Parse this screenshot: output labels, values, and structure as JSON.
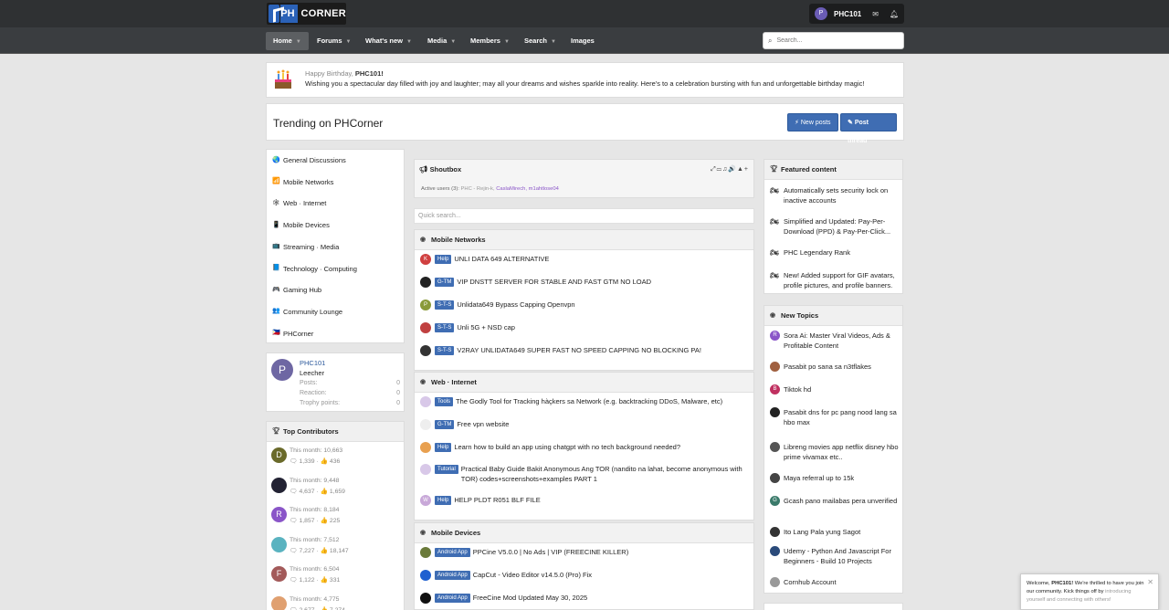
{
  "header": {
    "logo_ph": "PH",
    "logo_corner": "CORNER",
    "username": "PHC101",
    "avatar_letter": "P"
  },
  "nav": {
    "items": [
      "Home",
      "Forums",
      "What's new",
      "Media",
      "Members",
      "Search",
      "Images"
    ],
    "search_placeholder": "Search..."
  },
  "birthday": {
    "greeting": "Happy Birthday, ",
    "user": "PHC101!",
    "message": "Wishing you a spectacular day filled with joy and laughter; may all your dreams and wishes sparkle into reality. Here's to a celebration bursting with fun and unforgettable birthday magic!"
  },
  "trending": {
    "title": "Trending on PHCorner",
    "new_posts": "New posts",
    "post_thread": "Post thread"
  },
  "forums": [
    {
      "label": "General Discussions",
      "icon": "globe-icon",
      "glyph": "🌏"
    },
    {
      "label": "Mobile Networks",
      "icon": "signal-icon",
      "glyph": "📶"
    },
    {
      "label": "Web · Internet",
      "icon": "web-icon",
      "glyph": "🕸"
    },
    {
      "label": "Mobile Devices",
      "icon": "phone-icon",
      "glyph": "📱"
    },
    {
      "label": "Streaming · Media",
      "icon": "tv-icon",
      "glyph": "📺"
    },
    {
      "label": "Technology · Computing",
      "icon": "book-icon",
      "glyph": "📘"
    },
    {
      "label": "Gaming Hub",
      "icon": "gamepad-icon",
      "glyph": "🎮"
    },
    {
      "label": "Community Lounge",
      "icon": "people-icon",
      "glyph": "👥"
    },
    {
      "label": "PHCorner",
      "icon": "flag-icon",
      "glyph": "🇵🇭"
    }
  ],
  "profile": {
    "avatar_letter": "P",
    "name": "PHC101",
    "rank": "Leecher",
    "stats": [
      {
        "label": "Posts:",
        "value": "0"
      },
      {
        "label": "Reaction:",
        "value": "0"
      },
      {
        "label": "Trophy points:",
        "value": "0"
      }
    ]
  },
  "contributors": {
    "title": "Top Contributors",
    "items": [
      {
        "letter": "D",
        "color": "#6a6a2a",
        "month": "This month: 10,663",
        "stats": "🗨 1,339 · 👍 436"
      },
      {
        "letter": "",
        "color": "#223",
        "month": "This month: 9,448",
        "stats": "🗨 4,637 · 👍 1,659"
      },
      {
        "letter": "R",
        "color": "#8a55c8",
        "month": "This month: 8,184",
        "stats": "🗨 1,857 · 👍 225"
      },
      {
        "letter": "",
        "color": "#5ab3c0",
        "month": "This month: 7,512",
        "stats": "🗨 7,227 · 👍 18,147"
      },
      {
        "letter": "F",
        "color": "#a35a5a",
        "month": "This month: 6,504",
        "stats": "🗨 1,122 · 👍 331"
      },
      {
        "letter": "",
        "color": "#e0a070",
        "month": "This month: 4,775",
        "stats": "🗨 2,677 · 👍 7,274"
      }
    ]
  },
  "shoutbox": {
    "title": "Shoutbox",
    "active_label": "Active users (3):",
    "users": [
      "PHC - Rejin-k,",
      "CaslaMirech,",
      "m1ahtlose04"
    ],
    "quick_search": "Quick search..."
  },
  "sections": [
    {
      "title": "Mobile Networks",
      "rows": [
        {
          "av": "K",
          "color": "#d04040",
          "tag": "Help",
          "text": "UNLI DATA 649 ALTERNATIVE"
        },
        {
          "av": "",
          "color": "#222",
          "tag": "G-TM",
          "text": "VIP DNSTT SERVER FOR STABLE AND FAST GTM NO LOAD"
        },
        {
          "av": "P",
          "color": "#8a9a3a",
          "tag": "S-T-S",
          "text": "Unlidata649 Bypass Capping Openvpn"
        },
        {
          "av": "",
          "color": "#c04040",
          "tag": "S-T-S",
          "text": "Unli 5G + NSD cap"
        },
        {
          "av": "",
          "color": "#333",
          "tag": "S-T-S",
          "text": "V2RAY UNLIDATA649 SUPER FAST NO SPEED CAPPING NO BLOCKING PA!"
        }
      ]
    },
    {
      "title": "Web · Internet",
      "rows": [
        {
          "av": "",
          "color": "#d8c8e8",
          "tag": "Tools",
          "text": "The Godly Tool for Tracking hàçkers sa Network (e.g. backtracking DDoS, Malware, etc)"
        },
        {
          "av": "",
          "color": "#eee",
          "tag": "G-TM",
          "text": "Free vpn website"
        },
        {
          "av": "",
          "color": "#e8a050",
          "tag": "Help",
          "text": "Learn how to build an app using chatgpt with no tech background needed?"
        },
        {
          "av": "",
          "color": "#d8c8e8",
          "tag": "Tutorial",
          "text": "Practical Baby Guide Bakit Anonymous Ang TOR (nandito na lahat, become anonymous with TOR) codes+screenshots+examples PART 1"
        },
        {
          "av": "W",
          "color": "#c8a8d8",
          "tag": "Help",
          "text": "HELP PLDT R051 BLF FILE"
        }
      ]
    },
    {
      "title": "Mobile Devices",
      "rows": [
        {
          "av": "",
          "color": "#6a7a3a",
          "tag": "Android App",
          "text": "PPCine V5.0.0 | No Ads | VIP (FREECINE KILLER)"
        },
        {
          "av": "",
          "color": "#2060d0",
          "tag": "Android App",
          "text": "CapCut - Video Editor v14.5.0 (Pro) Fix"
        },
        {
          "av": "",
          "color": "#111",
          "tag": "Android App",
          "text": "FreeCine Mod Updated May 30, 2025"
        }
      ]
    }
  ],
  "featured": {
    "title": "Featured content",
    "items": [
      "Automatically sets security lock on inactive accounts",
      "Simplified and Updated: Pay-Per-Download (PPD) & Pay-Per-Click...",
      "PHC Legendary Rank",
      "New! Added support for GIF avatars, profile pictures, and profile banners."
    ]
  },
  "new_topics": {
    "title": "New Topics",
    "items": [
      {
        "av": "R",
        "color": "#8a55c8",
        "text": "Sora Ai: Master Viral Videos, Ads & Profitable Content"
      },
      {
        "av": "",
        "color": "#a06040",
        "text": "Pasabit po sana sa n3tflakes"
      },
      {
        "av": "B",
        "color": "#c03060",
        "text": "Tiktok hd"
      },
      {
        "av": "",
        "color": "#222",
        "text": "Pasabit dns for pc pang nood lang sa hbo max"
      },
      {
        "av": "",
        "color": "#555",
        "text": "Libreng movies app netflix disney hbo prime vivamax etc.."
      },
      {
        "av": "",
        "color": "#444",
        "text": "Maya referral up to 15k"
      },
      {
        "av": "G",
        "color": "#3a7a6a",
        "text": "Gcash pano mailabas pera unverified"
      },
      {
        "av": "",
        "color": "#333",
        "text": "Ito Lang Pala yung Sagot"
      },
      {
        "av": "",
        "color": "#2a4a7a",
        "text": "Udemy - Python And Javascript For Beginners - Build 10 Projects"
      },
      {
        "av": "",
        "color": "#999",
        "text": "Cornhub Account"
      }
    ]
  },
  "toast": {
    "welcome": "Welcome, ",
    "user": "PHC101!",
    "msg": " We're thrilled to have you join our community. Kick things off by ",
    "link": "introducing yourself and connecting with others!"
  }
}
